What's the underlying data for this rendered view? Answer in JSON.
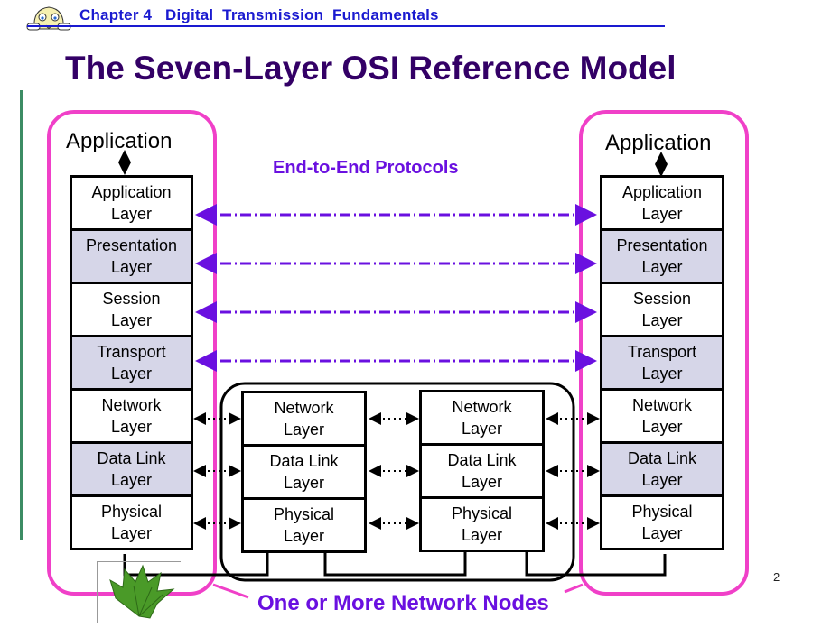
{
  "header": {
    "chapter": "Chapter 4   Digital  Transmission  Fundamentals",
    "mascot_icon": "peeking-face-icon"
  },
  "title": "The Seven-Layer OSI Reference Model",
  "diagram": {
    "end_system_left": {
      "application_label": "Application",
      "layers": [
        {
          "line1": "Application",
          "line2": "Layer",
          "shaded": false
        },
        {
          "line1": "Presentation",
          "line2": "Layer",
          "shaded": true
        },
        {
          "line1": "Session",
          "line2": "Layer",
          "shaded": false
        },
        {
          "line1": "Transport",
          "line2": "Layer",
          "shaded": true
        },
        {
          "line1": "Network",
          "line2": "Layer",
          "shaded": false
        },
        {
          "line1": "Data Link",
          "line2": "Layer",
          "shaded": true
        },
        {
          "line1": "Physical",
          "line2": "Layer",
          "shaded": false
        }
      ]
    },
    "end_system_right": {
      "application_label": "Application",
      "layers": [
        {
          "line1": "Application",
          "line2": "Layer",
          "shaded": false
        },
        {
          "line1": "Presentation",
          "line2": "Layer",
          "shaded": true
        },
        {
          "line1": "Session",
          "line2": "Layer",
          "shaded": false
        },
        {
          "line1": "Transport",
          "line2": "Layer",
          "shaded": true
        },
        {
          "line1": "Network",
          "line2": "Layer",
          "shaded": false
        },
        {
          "line1": "Data Link",
          "line2": "Layer",
          "shaded": true
        },
        {
          "line1": "Physical",
          "line2": "Layer",
          "shaded": false
        }
      ]
    },
    "network_nodes": [
      {
        "layers": [
          {
            "line1": "Network",
            "line2": "Layer"
          },
          {
            "line1": "Data Link",
            "line2": "Layer"
          },
          {
            "line1": "Physical",
            "line2": "Layer"
          }
        ]
      },
      {
        "layers": [
          {
            "line1": "Network",
            "line2": "Layer"
          },
          {
            "line1": "Data Link",
            "line2": "Layer"
          },
          {
            "line1": "Physical",
            "line2": "Layer"
          }
        ]
      }
    ],
    "end_to_end_label": "End-to-End Protocols",
    "network_nodes_label": "One or More Network Nodes",
    "colors": {
      "end_system_outline": "#f040c8",
      "end_to_end_arrow": "#6a10e0",
      "shaded_layer": "#d6d6e8",
      "header_blue": "#1a1ad0",
      "title_purple": "#330066",
      "accent_green": "#3c8c64"
    }
  },
  "page_number": "2"
}
